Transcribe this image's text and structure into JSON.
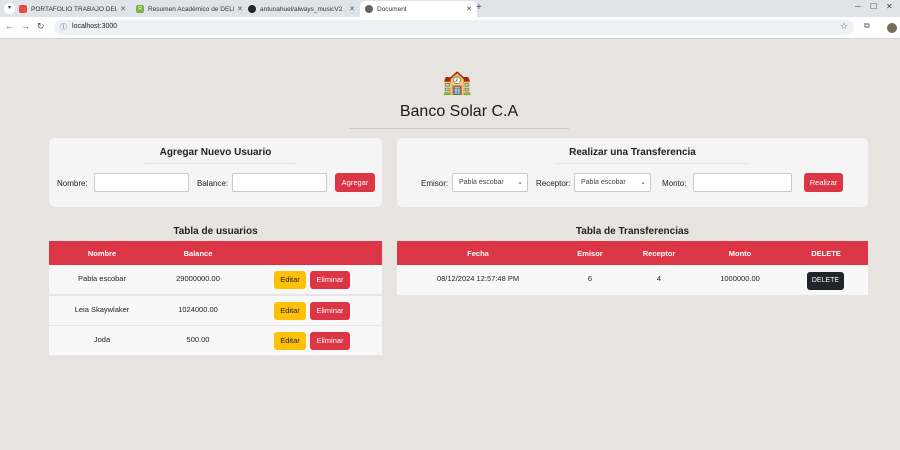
{
  "browser": {
    "tabs": [
      {
        "title": "PORTAFOLIO TRABAJO DELIA",
        "fav_color": "#e74c3c",
        "icon": "portfolio-favicon"
      },
      {
        "title": "Resumen Académico de DELIA",
        "fav_color": "#7cb342",
        "icon": "resume-favicon",
        "fav_text": "R"
      },
      {
        "title": "antunahuel/always_musicV2",
        "fav_color": "#24292e",
        "icon": "github-icon"
      },
      {
        "title": "Document",
        "fav_color": "#5f6368",
        "icon": "globe-icon"
      }
    ],
    "url": "localhost:3000"
  },
  "page": {
    "logo": "🏫",
    "title": "Banco Solar C.A"
  },
  "add_user": {
    "title": "Agregar Nuevo Usuario",
    "name_label": "Nombre:",
    "balance_label": "Balance:",
    "submit": "Agregar"
  },
  "transfer": {
    "title": "Realizar una Transferencia",
    "emisor_label": "Emisor:",
    "emisor_value": "Pabla escobar",
    "receptor_label": "Receptor:",
    "receptor_value": "Pabla escobar",
    "monto_label": "Monto:",
    "submit": "Realizar"
  },
  "users_table": {
    "title": "Tabla de usuarios",
    "headers": [
      "Nombre",
      "Balance"
    ],
    "rows": [
      {
        "nombre": "Pabla escobar",
        "balance": "29000000.00"
      },
      {
        "nombre": "Leia Skaywlaker",
        "balance": "1024000.00"
      },
      {
        "nombre": "Joda",
        "balance": "500.00"
      }
    ],
    "edit_label": "Editar",
    "delete_label": "Eliminar"
  },
  "transfers_table": {
    "title": "Tabla de Transferencias",
    "headers": [
      "Fecha",
      "Emisor",
      "Receptor",
      "Monto",
      "DELETE"
    ],
    "rows": [
      {
        "fecha": "08/12/2024 12:57:48 PM",
        "emisor": "6",
        "receptor": "4",
        "monto": "1000000.00"
      }
    ],
    "delete_label": "DELETE"
  },
  "colors": {
    "accent_red": "#dc3545",
    "edit_yellow": "#ffc107",
    "dark_button": "#212529",
    "page_bg": "#e7e3de"
  }
}
